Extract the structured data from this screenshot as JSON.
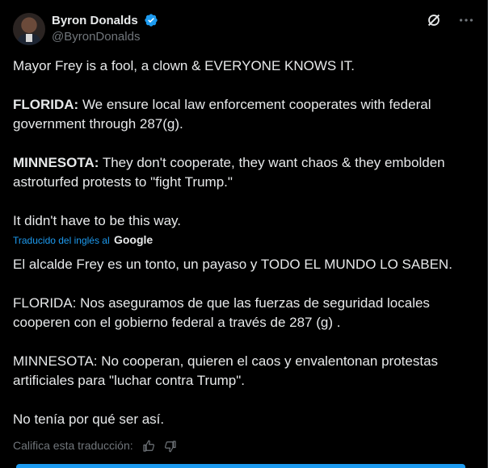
{
  "author": {
    "display_name": "Byron Donalds",
    "handle": "@ByronDonalds",
    "verified": true,
    "verified_color": "#1d9bf0"
  },
  "header_icons": [
    "grok-icon",
    "more-icon"
  ],
  "post": {
    "line1": "Mayor Frey is a fool, a clown & EVERYONE KNOWS IT.",
    "florida_label": "FLORIDA:",
    "florida_text": " We ensure local law enforcement cooperates with federal government through 287(g).",
    "minnesota_label": "MINNESOTA:",
    "minnesota_text": " They don't cooperate, they want chaos & they embolden astroturfed protests to \"fight Trump.\"",
    "closing": "It didn't have to be this way."
  },
  "translation": {
    "label": "Traducido del inglés al",
    "provider": "Google",
    "line1": "El alcalde Frey es un tonto, un payaso y TODO EL MUNDO LO SABEN.",
    "florida": "FLORIDA: Nos aseguramos de que las fuerzas de seguridad locales cooperen con el gobierno federal a través de 287 (g) .",
    "minnesota": "MINNESOTA: No cooperan, quieren el caos y envalentonan protestas artificiales para \"luchar contra Trump\".",
    "closing": "No tenía por qué ser así.",
    "rate_label": "Califica esta traducción:"
  },
  "colors": {
    "background": "#000000",
    "text": "#e7e9ea",
    "secondary": "#71767b",
    "accent": "#1d9bf0"
  }
}
